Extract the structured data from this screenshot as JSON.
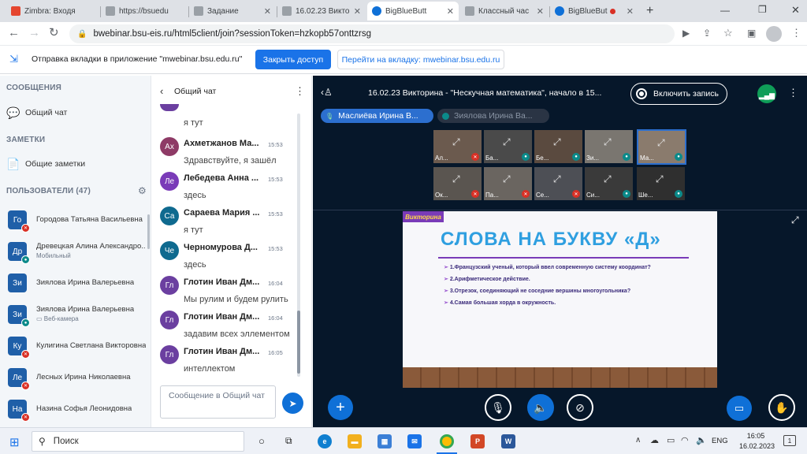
{
  "browser": {
    "tabs": [
      {
        "title": "Zimbra: Входя",
        "color": "#e5462f",
        "active": false
      },
      {
        "title": "https://bsuedu",
        "color": "#5f6368",
        "active": false
      },
      {
        "title": "Задание",
        "color": "#5f6368",
        "active": false
      },
      {
        "title": "16.02.23 Викто",
        "color": "#5f6368",
        "active": false
      },
      {
        "title": "BigBlueButt",
        "color": "#0f70d7",
        "active": true
      },
      {
        "title": "Классный час",
        "color": "#5f6368",
        "active": false
      },
      {
        "title": "BigBlueBut",
        "color": "#0f70d7",
        "active": false
      }
    ],
    "new_tab": "+",
    "url": "bwebinar.bsu-eis.ru/html5client/join?sessionToken=hzkopb57onttzrsg"
  },
  "infobar": {
    "message": "Отправка вкладки в приложение \"mwebinar.bsu.edu.ru\"",
    "share_button": "Закрыть доступ",
    "goto_button": "Перейти на вкладку: mwebinar.bsu.edu.ru"
  },
  "sidebar": {
    "messages_title": "СООБЩЕНИЯ",
    "public_chat": "Общий чат",
    "notes_title": "ЗАМЕТКИ",
    "shared_notes": "Общие заметки",
    "users_title": "ПОЛЬЗОВАТЕЛИ (47)",
    "users": [
      {
        "initials": "Го",
        "name": "Городова Татьяна Васильевна",
        "sub": "",
        "color": "#1f5fa8"
      },
      {
        "initials": "Др",
        "name": "Древецкая Алина Александро...",
        "sub": "Мобильный",
        "color": "#1f5fa8"
      },
      {
        "initials": "Зи",
        "name": "Зиялова Ирина Валерьевна",
        "sub": "",
        "color": "#1f5fa8"
      },
      {
        "initials": "Зи",
        "name": "Зиялова Ирина Валерьевна",
        "sub": "Веб-камера",
        "color": "#1f5fa8"
      },
      {
        "initials": "Ку",
        "name": "Кулигина Светлана Викторовна",
        "sub": "",
        "color": "#1f5fa8"
      },
      {
        "initials": "Ле",
        "name": "Лесных Ирина Николаевна",
        "sub": "",
        "color": "#1f5fa8"
      },
      {
        "initials": "На",
        "name": "Назина Софья Леонидовна",
        "sub": "",
        "color": "#1f5fa8"
      }
    ]
  },
  "chat": {
    "title": "Общий чат",
    "partial_text": "я тут",
    "messages": [
      {
        "initials": "Ах",
        "name": "Ахметжанов Ма...",
        "time": "15:53",
        "text": "Здравствуйте, я зашёл",
        "color": "#8e3a66"
      },
      {
        "initials": "Ле",
        "name": "Лебедева Анна ...",
        "time": "15:53",
        "text": "здесь",
        "color": "#7a3bb8"
      },
      {
        "initials": "Са",
        "name": "Сараева Мария ...",
        "time": "15:53",
        "text": "я тут",
        "color": "#0f6a8f"
      },
      {
        "initials": "Че",
        "name": "Черномурова Д...",
        "time": "15:53",
        "text": "здесь",
        "color": "#0f6a8f"
      },
      {
        "initials": "Гл",
        "name": "Глотин Иван Дм...",
        "time": "16:04",
        "text": "Мы рулим и будем рулить",
        "color": "#6b3fa0"
      },
      {
        "initials": "Гл",
        "name": "Глотин Иван Дм...",
        "time": "16:04",
        "text": "задавим всех эллементом",
        "color": "#6b3fa0"
      },
      {
        "initials": "Гл",
        "name": "Глотин Иван Дм...",
        "time": "16:05",
        "text": "интеллектом",
        "color": "#6b3fa0"
      }
    ],
    "input_placeholder": "Сообщение в Общий чат"
  },
  "meeting": {
    "title": "16.02.23 Викторина - \"Нескучная математика\", начало в 15...",
    "record_button": "Включить запись",
    "talkers": [
      {
        "name": "Маслиёва Ирина В...",
        "active": true
      },
      {
        "name": "Зиялова Ирина Ва...",
        "active": false
      }
    ],
    "videos": [
      {
        "label": "Ал...",
        "mic": "muted",
        "bg": "#6b5a4e"
      },
      {
        "label": "Ба...",
        "mic": "on",
        "bg": "#4a4a4a"
      },
      {
        "label": "Бе...",
        "mic": "on",
        "bg": "#5a4a3f"
      },
      {
        "label": "Зи...",
        "mic": "on",
        "bg": "#7a7670"
      },
      {
        "label": "Ма...",
        "mic": "on",
        "bg": "#8a7b6d"
      },
      {
        "label": "Ок...",
        "mic": "muted",
        "bg": "#5a5550"
      },
      {
        "label": "Па...",
        "mic": "muted",
        "bg": "#6a6560"
      },
      {
        "label": "Се...",
        "mic": "muted",
        "bg": "#4d4f55"
      },
      {
        "label": "Си...",
        "mic": "on",
        "bg": "#3a3a3a"
      },
      {
        "label": "Ше...",
        "mic": "on",
        "bg": "#2f2f2f"
      }
    ],
    "slide": {
      "tag": "Викторина",
      "title": "СЛОВА НА БУКВУ «Д»",
      "items": [
        "1.Французский ученый, который ввел современную систему координат?",
        "2.Арифметическое действие.",
        "3.Отрезок, соединяющий не соседние вершины многоугольника?",
        "4.Самая большая хорда в окружность."
      ]
    }
  },
  "taskbar": {
    "search": "Поиск",
    "lang": "ENG",
    "time": "16:05",
    "date": "16.02.2023",
    "notif_count": "1"
  }
}
